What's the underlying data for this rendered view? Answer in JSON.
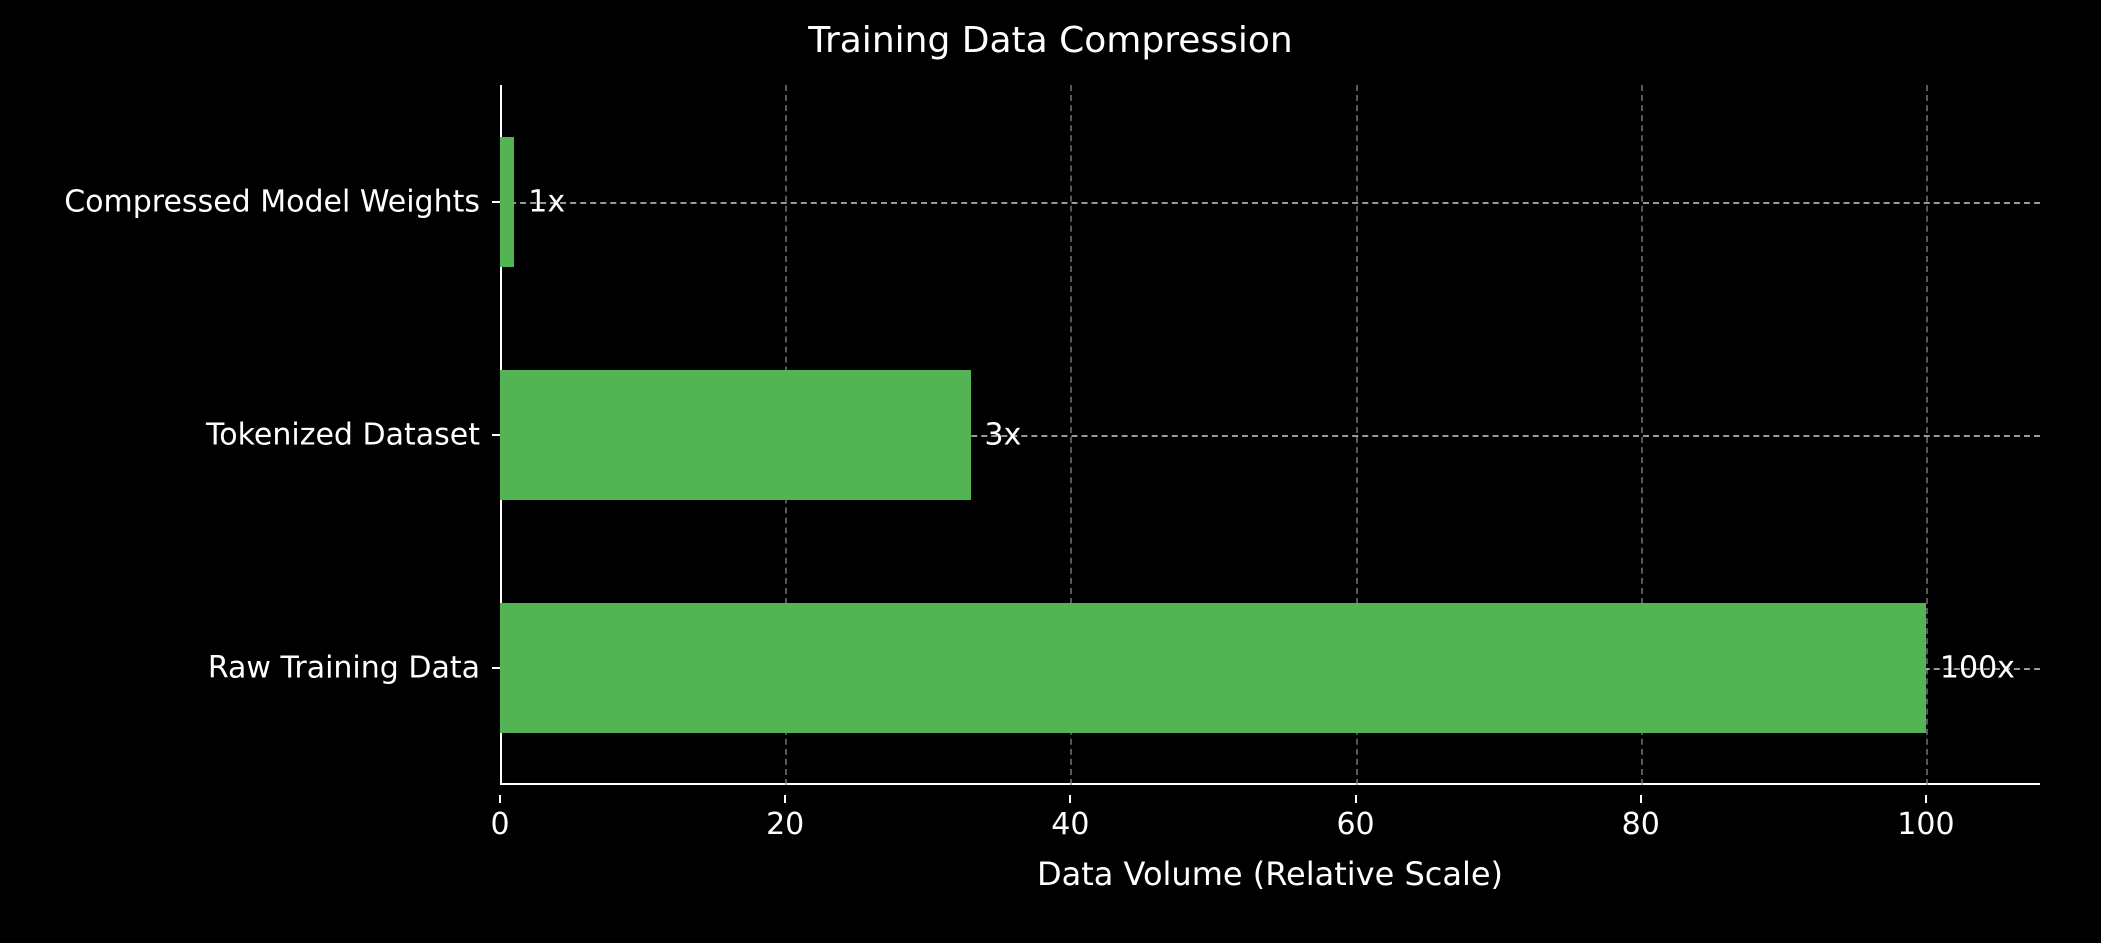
{
  "chart_data": {
    "type": "bar",
    "orientation": "horizontal",
    "title": "Training Data Compression",
    "xlabel": "Data Volume (Relative Scale)",
    "ylabel": "",
    "categories": [
      "Raw Training Data",
      "Tokenized Dataset",
      "Compressed Model Weights"
    ],
    "values": [
      100,
      33,
      1
    ],
    "value_labels": [
      "100x",
      "3x",
      "1x"
    ],
    "xlim": [
      0,
      108
    ],
    "xticks": [
      0,
      20,
      40,
      60,
      80,
      100
    ],
    "bar_color": "#53b456",
    "background": "#000000",
    "grid": true
  }
}
